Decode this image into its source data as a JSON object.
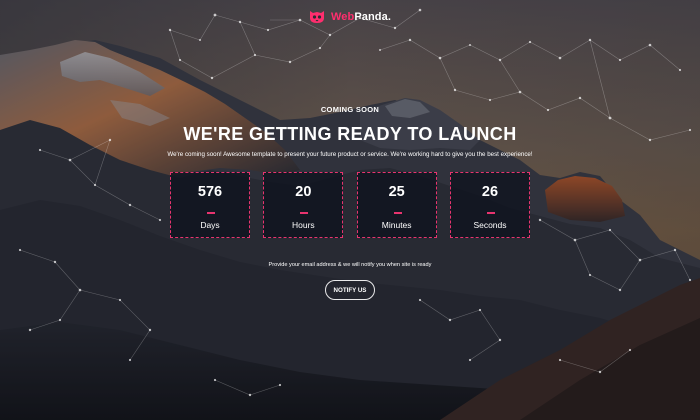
{
  "brand": {
    "logo_prefix": "Web",
    "logo_suffix": "Panda.",
    "accent_color": "#ff2e6e",
    "logo_icon": "panda-icon"
  },
  "hero": {
    "eyebrow": "COMING SOON",
    "headline": "WE'RE GETTING READY TO LAUNCH",
    "subtext": "We're coming soon! Awesome template to present your future product or service. We're working hard to give you the best experience!"
  },
  "countdown": [
    {
      "value": "576",
      "label": "Days"
    },
    {
      "value": "20",
      "label": "Hours"
    },
    {
      "value": "25",
      "label": "Minutes"
    },
    {
      "value": "26",
      "label": "Seconds"
    }
  ],
  "notify": {
    "text": "Provide your email address & we will notify you when site is ready",
    "button_label": "NOTIFY US"
  },
  "colors": {
    "box_border": "#e8346f",
    "text": "#ffffff"
  }
}
